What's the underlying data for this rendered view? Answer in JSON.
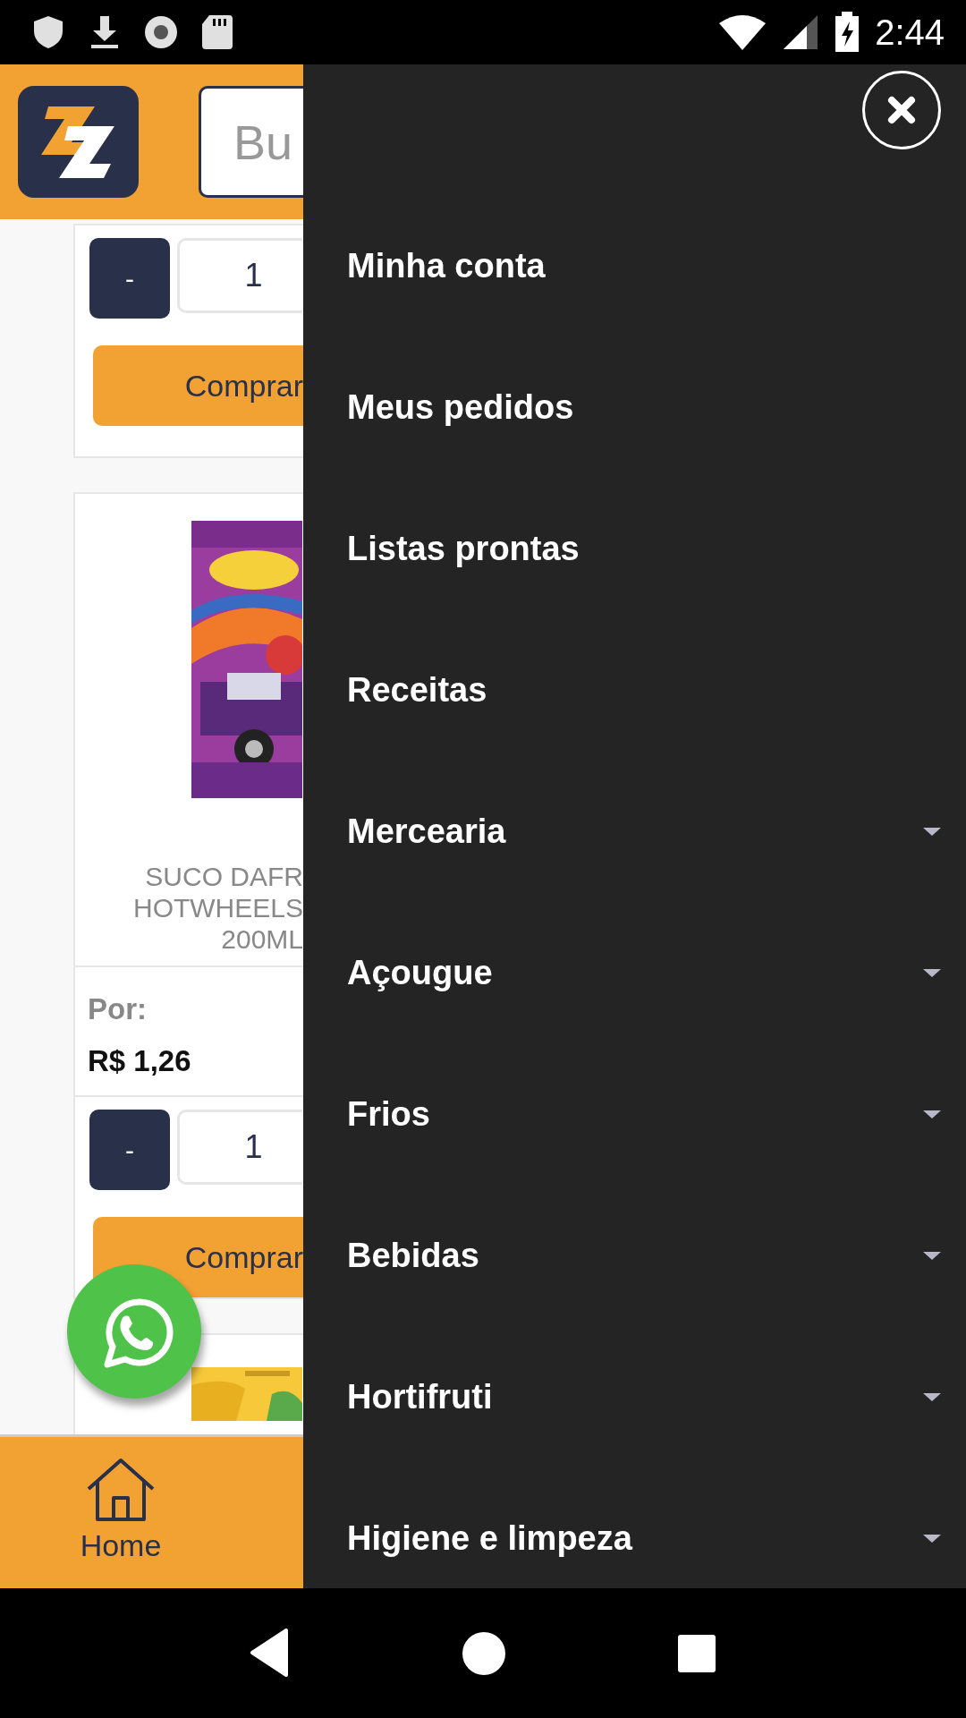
{
  "status_bar": {
    "time": "2:44"
  },
  "header": {
    "search": {
      "placeholder": "Bu"
    }
  },
  "cards": [
    {
      "kind": "partial",
      "minus": "-",
      "quantity": "1",
      "buy": "Comprar"
    },
    {
      "kind": "full",
      "name_lines": [
        "SUCO DAFR",
        "HOTWHEELS",
        "200ML"
      ],
      "price_label": "Por:",
      "price": "R$ 1,26",
      "minus": "-",
      "quantity": "1",
      "buy": "Comprar"
    },
    {
      "kind": "peek"
    }
  ],
  "bottom_nav": [
    {
      "label": "Home"
    }
  ],
  "drawer": {
    "items": [
      {
        "label": "Minha conta",
        "kind": "link"
      },
      {
        "label": "Meus pedidos",
        "kind": "link"
      },
      {
        "label": "Listas prontas",
        "kind": "link"
      },
      {
        "label": "Receitas",
        "kind": "link"
      },
      {
        "label": "Mercearia",
        "kind": "dropdown"
      },
      {
        "label": "Açougue",
        "kind": "dropdown"
      },
      {
        "label": "Frios",
        "kind": "dropdown"
      },
      {
        "label": "Bebidas",
        "kind": "dropdown"
      },
      {
        "label": "Hortifruti",
        "kind": "dropdown"
      },
      {
        "label": "Higiene e limpeza",
        "kind": "dropdown"
      }
    ]
  }
}
